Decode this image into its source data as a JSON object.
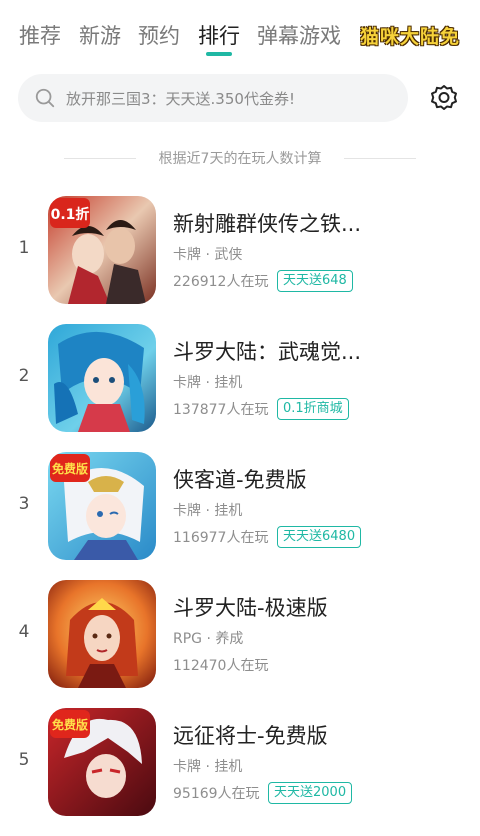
{
  "tabs": [
    {
      "label": "推荐",
      "active": false
    },
    {
      "label": "新游",
      "active": false
    },
    {
      "label": "预约",
      "active": false
    },
    {
      "label": "排行",
      "active": true
    },
    {
      "label": "弹幕游戏",
      "active": false
    }
  ],
  "promo_logo": "猫咪大陆免",
  "search": {
    "placeholder": "放开那三国3：天天送.350代金券!"
  },
  "ranking_note": "根据近7天的在玩人数计算",
  "games": [
    {
      "rank": "1",
      "name": "新射雕群侠传之铁...",
      "tags": "卡牌 · 武侠",
      "players": "226912人在玩",
      "badge": "天天送648",
      "icon_badge": "0.1折"
    },
    {
      "rank": "2",
      "name": "斗罗大陆：武魂觉...",
      "tags": "卡牌 · 挂机",
      "players": "137877人在玩",
      "badge": "0.1折商城"
    },
    {
      "rank": "3",
      "name": "侠客道-免费版",
      "tags": "卡牌 · 挂机",
      "players": "116977人在玩",
      "badge": "天天送6480",
      "icon_badge": "免费版"
    },
    {
      "rank": "4",
      "name": "斗罗大陆-极速版",
      "tags": "RPG · 养成",
      "players": "112470人在玩",
      "badge": ""
    },
    {
      "rank": "5",
      "name": "远征将士-免费版",
      "tags": "卡牌 · 挂机",
      "players": "95169人在玩",
      "badge": "天天送2000",
      "icon_badge": "免费版"
    }
  ],
  "colors": {
    "accent": "#1fb8a4",
    "text_primary": "#222222",
    "text_secondary": "#8e8e8e"
  }
}
